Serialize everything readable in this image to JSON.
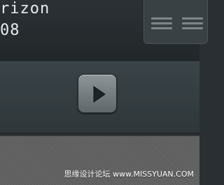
{
  "track_info": {
    "line_1": "rizon",
    "line_2": "08"
  },
  "side_card": {
    "icon": "list-icon"
  },
  "player": {
    "play_icon": "play-icon",
    "play_button_color": "#7c8488"
  },
  "watermark": {
    "text": "思缘设计论坛 www.MISSYUAN.COM"
  }
}
